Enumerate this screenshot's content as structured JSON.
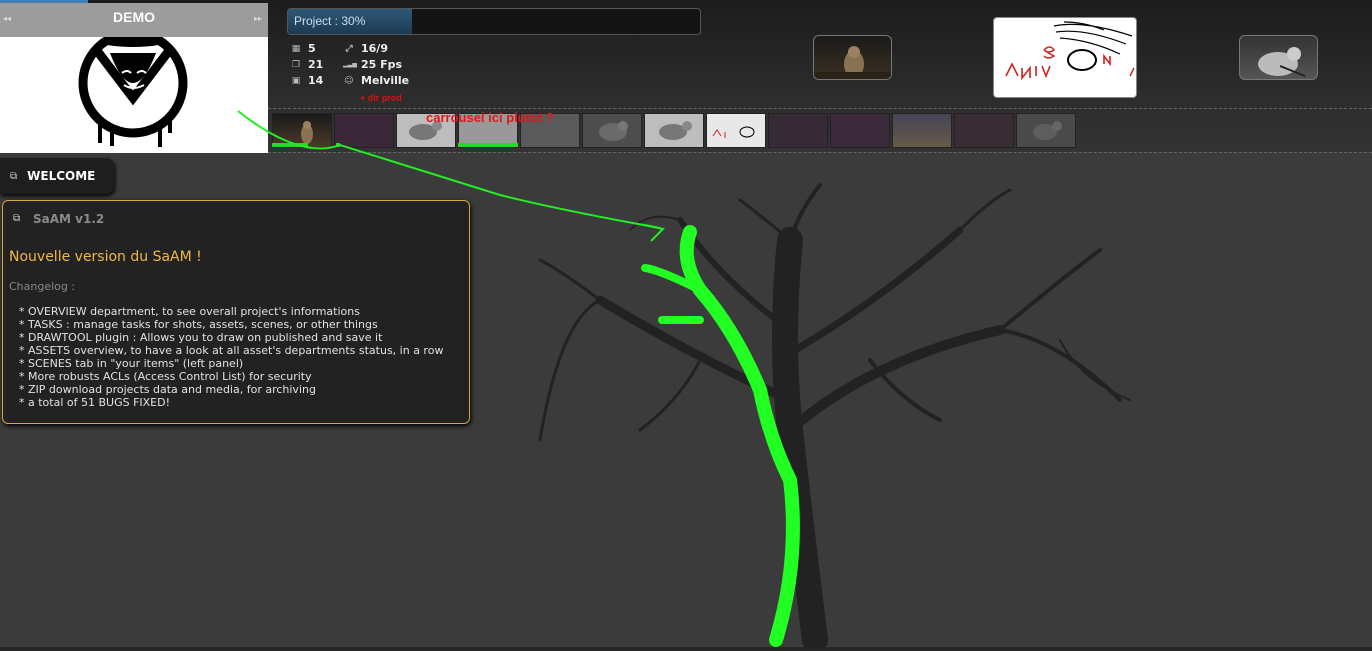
{
  "project": {
    "name": "DEMO",
    "progress_label": "Project : 30%",
    "progress_percent": 30
  },
  "info": {
    "items": [
      {
        "icon": "film-icon",
        "glyph": "▦",
        "value": "5"
      },
      {
        "icon": "copy-icon",
        "glyph": "❐",
        "value": "21"
      },
      {
        "icon": "image-icon",
        "glyph": "▣",
        "value": "14"
      },
      {
        "icon": "ratio-icon",
        "glyph": "⤢",
        "value": "16/9"
      },
      {
        "icon": "signal-icon",
        "glyph": "▂▃▅",
        "value": "25 Fps"
      },
      {
        "icon": "user-icon",
        "glyph": "☺",
        "value": "Melville"
      }
    ],
    "dir_prod": "+ dir prod"
  },
  "annotation": "carrousel ici plutot ?",
  "welcome": {
    "label": "WELCOME"
  },
  "panel": {
    "title": "SaAM v1.2",
    "heading": "Nouvelle version du SaAM !",
    "sub": "Changelog :",
    "changelog": [
      "* OVERVIEW department, to see overall project's informations",
      "* TASKS : manage tasks for shots, assets, scenes, or other things",
      "* DRAWTOOL plugin : Allows you to draw on published and save it",
      "* ASSETS overview, to have a look at all asset's departments status, in a row",
      "* SCENES tab in \"your items\" (left panel)",
      "* More robusts ACLs (Access Control List) for security",
      "* ZIP download projects data and media, for archiving",
      "* a total of 51 BUGS FIXED!"
    ]
  },
  "colors": {
    "accent": "#d9a53f",
    "annotation_red": "#e01818",
    "green_mark": "#22ff22",
    "progress": "#2e5878"
  }
}
